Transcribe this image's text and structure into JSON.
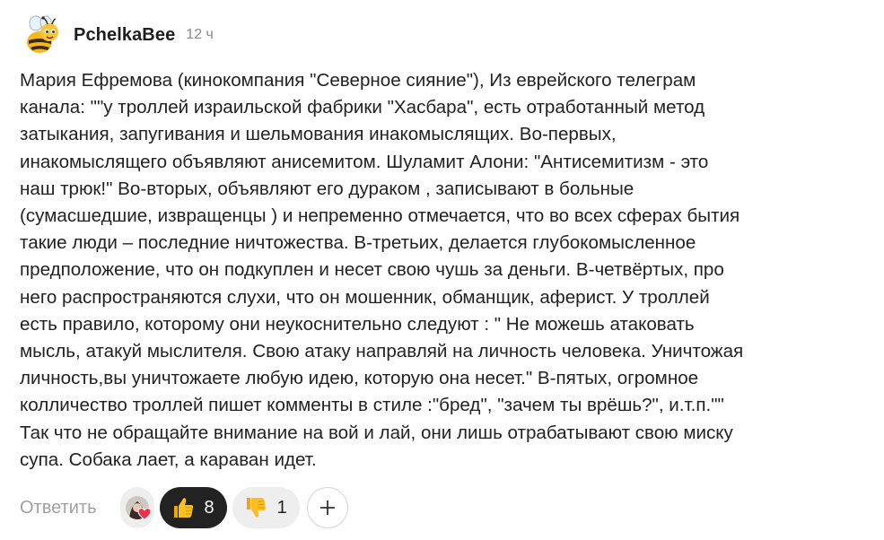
{
  "comment": {
    "author": "PchelkaBee",
    "time": "12 ч",
    "avatar_icon": "bee-avatar-icon",
    "text": "Мария Ефремова (кинокомпания \"Северное сияние\"), Из еврейского телеграм\nканала: \"\"у троллей израильской фабрики \"Хасбара\", есть отработанный метод\nзатыкания, запугивания и шельмования инакомыслящих. Во-первых,\nинакомыслящего объявляют анисемитом. Шуламит Алони: \"Антисемитизм - это\nнаш трюк!\" Во-вторых, объявляют его дураком , записывают в больные\n(сумасшедшие, извращенцы ) и непременно отмечается, что во всех сферах бытия\nтакие люди – последние ничтожества. В-третьих, делается глубокомысленное\nпредположение, что он подкуплен и несет свою чушь за деньги. В-четвёртых, про\nнего распространяются слухи, что он мошенник, обманщик, аферист. У троллей\nесть правило, которому они неукоснительно следуют : \" Не можешь атаковать\nмысль, атакуй мыслителя. Свою атаку направляй на личность человека. Уничтожая\nличность,вы уничтожаете любую идею, которую она несет.\" В-пятых, огромное\nколличество троллей пишет комменты в стиле :\"бред\", \"зачем ты врёшь?\", и.т.п.\"\"\nТак что не обращайте внимание на вой и лай, они лишь отрабатывают свою миску\nсупа. Собака лает, а караван идет."
  },
  "actions": {
    "reply_label": "Ответить",
    "reactor_icon": "reactor-avatar-with-heart-icon",
    "like": {
      "icon": "thumbs-up-icon",
      "count": "8",
      "active": true
    },
    "dislike": {
      "icon": "thumbs-down-icon",
      "count": "1",
      "active": false
    },
    "add_reaction_icon": "plus-icon"
  },
  "colors": {
    "text": "#222222",
    "muted": "#8a8a8a",
    "reply": "#a0a0a0",
    "pill_bg": "#eeeeee",
    "active_pill_bg": "#222222",
    "accent_yellow": "#f5b81c"
  }
}
